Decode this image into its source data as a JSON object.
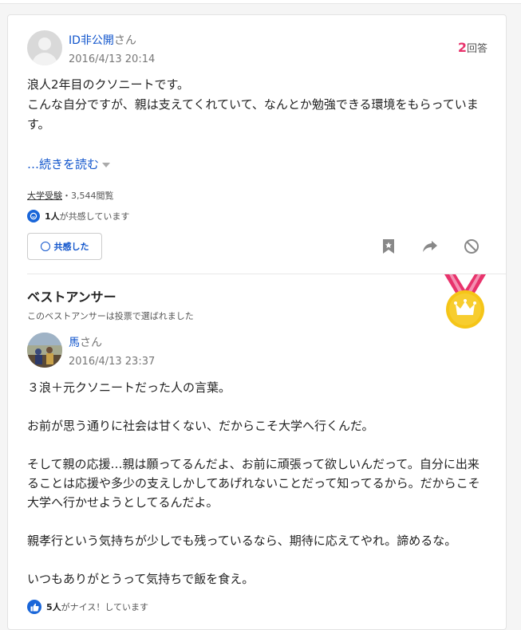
{
  "question": {
    "user_name": "ID非公開",
    "user_suffix": "さん",
    "date": "2016/4/13 20:14",
    "answer_count": "2",
    "answer_label": "回答",
    "body_line1": "浪人2年目のクソニートです。",
    "body_line2": "こんな自分ですが、親は支えてくれていて、なんとか勉強できる環境をもらっています。",
    "read_more": "…続きを読む",
    "category": "大学受験",
    "views": "・3,544閲覧",
    "empathy_count": "1人",
    "empathy_text": "が共感しています",
    "empathy_button": "共感した"
  },
  "best_answer": {
    "title": "ベストアンサー",
    "subtitle": "このベストアンサーは投票で選ばれました",
    "user_name": "馬",
    "user_suffix": "さん",
    "date": "2016/4/13 23:37",
    "paragraphs": [
      "３浪＋元クソニートだった人の言葉。",
      "お前が思う通りに社会は甘くない、だからこそ大学へ行くんだ。",
      "そして親の応援…親は願ってるんだよ、お前に頑張って欲しいんだって。自分に出来ることは応援や多少の支えしかしてあげれないことだって知ってるから。だからこそ大学へ行かせようとしてるんだよ。",
      "親孝行という気持ちが少しでも残っているなら、期待に応えてやれ。諦めるな。",
      "いつもありがとうって気持ちで飯を食え。"
    ],
    "nice_count": "5人",
    "nice_text": "がナイス！しています"
  },
  "colors": {
    "accent_blue": "#1155cc",
    "answer_count_pink": "#e8336c",
    "medal_gold": "#f5c518",
    "ribbon_pink": "#e8336c"
  },
  "icons": [
    "empathy-icon",
    "bookmark-icon",
    "share-icon",
    "block-icon",
    "medal-icon",
    "thumbs-up-icon"
  ]
}
